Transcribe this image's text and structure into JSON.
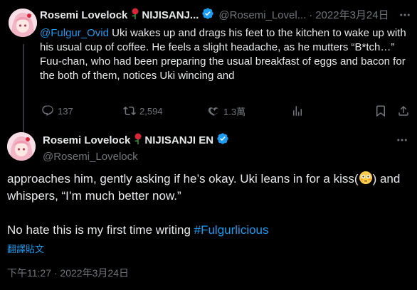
{
  "reply": {
    "display_name": "Rosemi Lovelock",
    "name_suffix": "NIJISANJ...",
    "handle": "@Rosemi_Lovel...",
    "separator": "·",
    "date": "2022年3月24日",
    "mention": "@Fulgur_Ovid",
    "text_after_mention": " Uki wakes up and drags his feet to the kitchen to wake up with his usual cup of coffee. He feels a slight headache, as he mutters “B*tch…”",
    "text_line2": "Fuu-chan, who had been preparing the usual breakfast of eggs and bacon for the both of them, notices Uki wincing and",
    "actions": {
      "replies": "137",
      "retweets": "2,594",
      "likes": "1.3萬"
    }
  },
  "main": {
    "display_name": "Rosemi Lovelock",
    "name_suffix": "NIJISANJI EN",
    "handle": "@Rosemi_Lovelock",
    "text_line1_a": "approaches him, gently asking if he’s okay. Uki leans in for a kiss(",
    "text_line1_b": ") and whispers, “I’m much better now.”",
    "text_line2_a": "No hate this is my first time writing ",
    "hashtag": "#Fulgurlicious",
    "translate_label": "翻譯貼文",
    "timestamp": "下午11:27 · 2022年3月24日"
  },
  "colors": {
    "background": "#000000",
    "text": "#e7e9ea",
    "muted": "#71767b",
    "accent": "#1d9bf0",
    "verified": "#1d9bf0"
  },
  "icons": [
    "rose-icon",
    "verified-icon",
    "more-icon",
    "reply-icon",
    "retweet-icon",
    "like-icon",
    "views-icon",
    "bookmark-icon",
    "share-icon",
    "flushed-emoji-icon"
  ]
}
